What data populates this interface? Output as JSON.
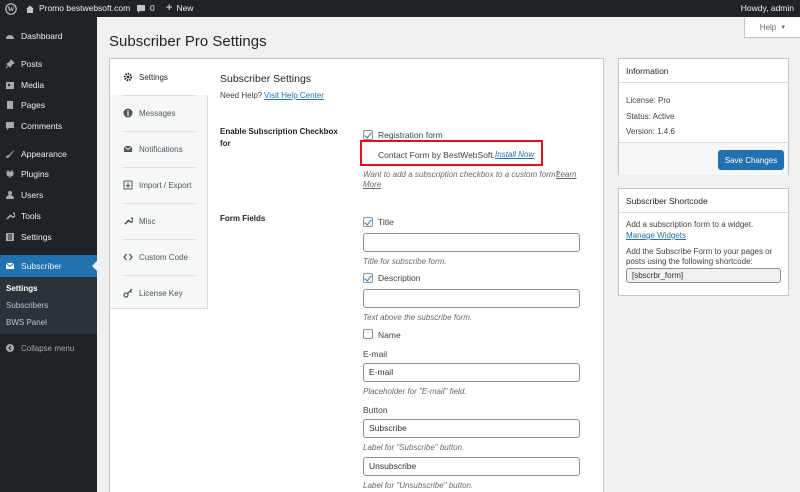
{
  "adminbar": {
    "site_name": "Promo bestwebsoft.com",
    "comments_count": "0",
    "new_label": "New",
    "howdy": "Howdy, admin"
  },
  "sidebar": {
    "items": [
      {
        "label": "Dashboard",
        "icon": "dashboard-icon"
      },
      {
        "label": "Posts",
        "icon": "pin-icon"
      },
      {
        "label": "Media",
        "icon": "media-icon"
      },
      {
        "label": "Pages",
        "icon": "page-icon"
      },
      {
        "label": "Comments",
        "icon": "comment-icon"
      },
      {
        "label": "Appearance",
        "icon": "brush-icon"
      },
      {
        "label": "Plugins",
        "icon": "plug-icon"
      },
      {
        "label": "Users",
        "icon": "user-icon"
      },
      {
        "label": "Tools",
        "icon": "wrench-icon"
      },
      {
        "label": "Settings",
        "icon": "settings-icon"
      },
      {
        "label": "Subscriber",
        "icon": "envelope-icon"
      }
    ],
    "submenu": [
      "Settings",
      "Subscribers",
      "BWS Panel"
    ],
    "collapse": "Collapse menu"
  },
  "header": {
    "title": "Subscriber Pro Settings",
    "help_label": "Help"
  },
  "tabs": [
    "Settings",
    "Messages",
    "Notifications",
    "Import / Export",
    "Misc",
    "Custom Code",
    "License Key"
  ],
  "settings": {
    "heading": "Subscriber Settings",
    "need_help": "Need Help?",
    "help_center": "Visit Help Center",
    "enable_label_1": "Enable Subscription Checkbox",
    "enable_label_2": "for",
    "registration_form": "Registration form",
    "contact_form": "Contact Form by BestWebSoft.",
    "install_now": "Install Now",
    "custom_form_note": "Want to add a subscription checkbox to a custom form?",
    "learn_1": "Learn",
    "learn_2": "More",
    "form_fields_label": "Form Fields",
    "title_label": "Title",
    "title_value": "",
    "title_desc": "Title for subscribe form.",
    "description_label": "Description",
    "description_value": "",
    "description_desc": "Text above the subscribe form.",
    "name_label": "Name",
    "email_label": "E-mail",
    "email_value": "E-mail",
    "email_desc": "Placeholder for \"E-mail\" field.",
    "button_label": "Button",
    "subscribe_value": "Subscribe",
    "subscribe_desc": "Label for \"Subscribe\" button.",
    "unsubscribe_value": "Unsubscribe",
    "unsubscribe_desc": "Label for \"Unsubscribe\" button."
  },
  "info": {
    "heading": "Information",
    "license": "License: Pro",
    "status": "Status: Active",
    "version": "Version: 1.4.6",
    "save_label": "Save Changes"
  },
  "shortcode_box": {
    "heading": "Subscriber Shortcode",
    "text1": "Add a subscription form to a widget.",
    "manage_widgets": "Manage Widgets",
    "text2_line1": "Add the Subscribe Form to your pages or",
    "text2_line2": "posts using the following shortcode:",
    "shortcode": "[sbscrbr_form]"
  },
  "colors": {
    "accent": "#2271b1",
    "admin_dark": "#1d2327",
    "highlight": "#e0111a"
  }
}
